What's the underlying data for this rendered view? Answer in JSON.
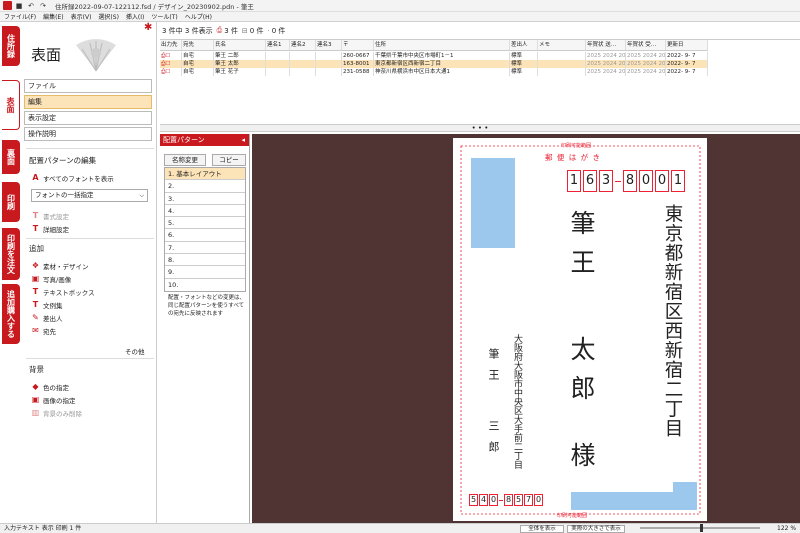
{
  "window": {
    "title": "住所録2022-09-07-122112.fsd / デザイン_20230902.pdn - 筆王"
  },
  "menu": [
    "ファイル(F)",
    "編集(E)",
    "表示(V)",
    "選択(S)",
    "挿入(I)",
    "ツール(T)",
    "ヘルプ(H)"
  ],
  "vtabs": [
    "住所録",
    "表面",
    "裏面",
    "印刷",
    "印刷を注文",
    "追加購入する"
  ],
  "left": {
    "title": "表面",
    "buttons": [
      "ファイル",
      "編集",
      "表示設定",
      "操作説明"
    ],
    "pattern_edit_header": "配置パターンの編集",
    "show_all_fonts": "すべてのフォントを表示",
    "font_combo": "フォントの一括指定",
    "format_setting": "書式設定",
    "detail_setting": "詳細設定",
    "add_header": "追加",
    "add_items": [
      "素材・デザイン",
      "写真/画像",
      "テキストボックス",
      "文例集",
      "差出人",
      "宛先"
    ],
    "other": "その他",
    "bg_header": "背景",
    "bg_items": [
      "色の指定",
      "画像の指定",
      "背景のみ削除"
    ]
  },
  "list_header": {
    "count": "3 件中 3 件表示",
    "print_count": "3 件",
    "excl_count": "0 件",
    "other_count": "0 件"
  },
  "table": {
    "columns": [
      "出力先",
      "宛先",
      "氏名",
      "連名1",
      "連名2",
      "連名3",
      "〒",
      "住所",
      "差出人",
      "メモ",
      "年賀状 送…",
      "年賀状 受…",
      "更新日"
    ],
    "rows": [
      {
        "dest": "自宅",
        "name": "筆王 二郎",
        "zip": "260-0667",
        "addr": "千葉県千葉市中央区市場町1－1",
        "sender": "標準",
        "sent": "2025 2024 20",
        "recv": "2025 2024 20",
        "updated": "2022- 9- 7"
      },
      {
        "dest": "自宅",
        "name": "筆王 太郎",
        "zip": "163-8001",
        "addr": "東京都新宿区西新宿二丁目",
        "sender": "標準",
        "sent": "2025 2024 20",
        "recv": "2025 2024 20",
        "updated": "2022- 9- 7"
      },
      {
        "dest": "自宅",
        "name": "筆王 花子",
        "zip": "231-0588",
        "addr": "神奈川県横浜市中区日本大通1",
        "sender": "標準",
        "sent": "2025 2024 20",
        "recv": "2025 2024 20",
        "updated": "2022- 9- 7"
      }
    ]
  },
  "divider_dots": "• • •",
  "pattern": {
    "title": "配置パターン",
    "btn_rename": "名称変更",
    "btn_copy": "コピー",
    "items": [
      "1. 基本レイアウト",
      "2.",
      "3.",
      "4.",
      "5.",
      "6.",
      "7.",
      "8.",
      "9.",
      "10."
    ],
    "note": "配置・フォントなどの変更は、同じ配置パターンを使うすべての宛先に反映されます"
  },
  "card": {
    "printable_area": "印刷可能範囲",
    "postcard_label": "郵 便 は が き",
    "zip": [
      "1",
      "6",
      "3",
      "8",
      "0",
      "0",
      "1"
    ],
    "address": "東京都新宿区西新宿二丁目",
    "name_family": "筆王",
    "name_given": "太郎",
    "honorific": "様",
    "sender_address": "大阪府大阪市中央区大手前二丁目",
    "sender_family": "筆王",
    "sender_given": "三郎",
    "sender_zip": [
      "5",
      "4",
      "0",
      "8",
      "5",
      "7",
      "0"
    ]
  },
  "status": {
    "left": "入力テキスト 表示 印刷 1 件",
    "zoom": "122 %",
    "btn_fit": "全体を表示",
    "btn_actual": "実際の大きさで表示"
  },
  "colors": {
    "accent": "#c8191e",
    "canvas": "#4f3433",
    "placeholder": "#9cc8ee",
    "highlight": "#fde3b8"
  }
}
